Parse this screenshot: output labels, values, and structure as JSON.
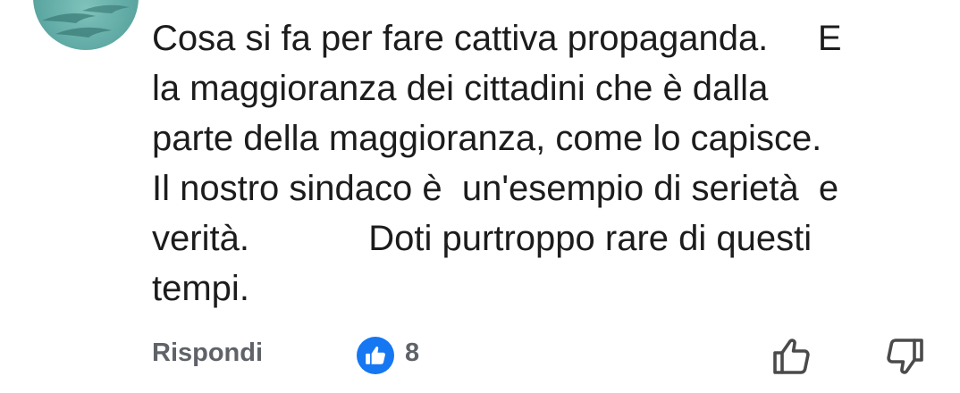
{
  "comment": {
    "lines": [
      "Cosa si fa per fare cattiva propaganda.     E",
      "la maggioranza dei cittadini che è dalla",
      "parte della maggioranza, come lo capisce.",
      "Il nostro sindaco è  un'esempio di serietà  e",
      "verità.            Doti purtroppo rare di questi",
      "tempi."
    ]
  },
  "actions": {
    "reply_label": "Rispondi",
    "like_count": "8"
  },
  "icons": {
    "like_badge": "thumbs-up-icon",
    "upvote": "thumbs-up-outline-icon",
    "downvote": "thumbs-down-outline-icon"
  },
  "colors": {
    "text": "#1c1c1c",
    "muted": "#5f6368",
    "like_blue": "#1677f2",
    "avatar_teal": "#5ea8a3"
  }
}
